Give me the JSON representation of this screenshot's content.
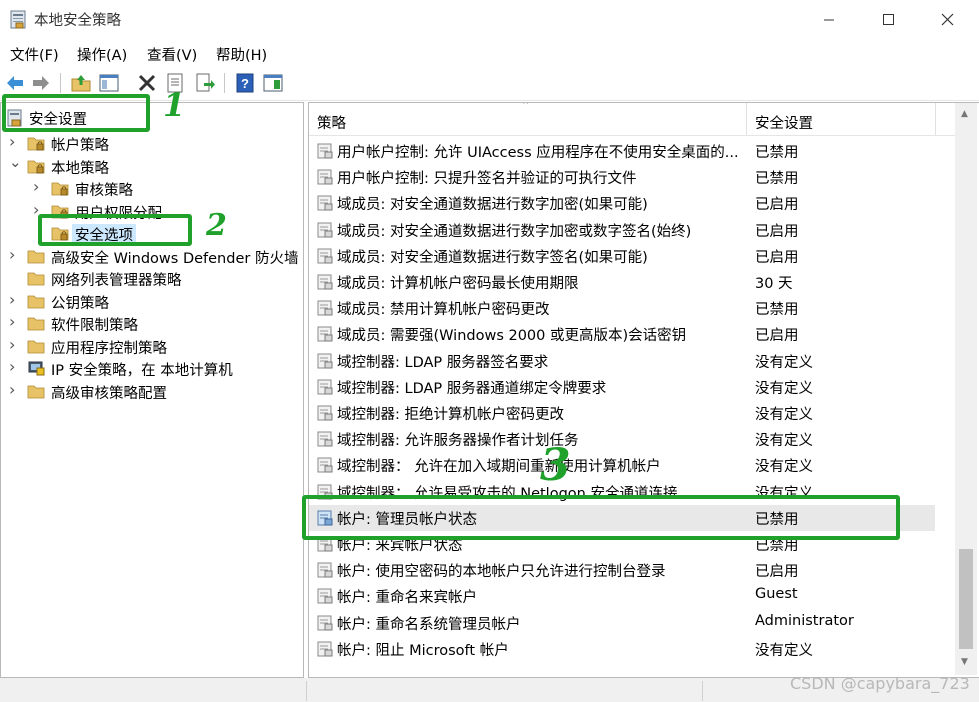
{
  "window": {
    "title": "本地安全策略",
    "controls": {
      "minimize": "minimize-icon",
      "maximize": "maximize-icon",
      "close": "close-icon"
    }
  },
  "menu": [
    "文件(F)",
    "操作(A)",
    "查看(V)",
    "帮助(H)"
  ],
  "toolbar": [
    "back-arrow-icon",
    "forward-arrow-icon",
    "up-folder-icon",
    "show-hide-tree-icon",
    "delete-icon",
    "properties-icon",
    "export-list-icon",
    "help-icon",
    "console-pane-icon"
  ],
  "tree": {
    "root": "安全设置",
    "items": [
      {
        "label": "帐户策略",
        "level": 1,
        "expand": "collapsed",
        "icon": "folder-lock-icon"
      },
      {
        "label": "本地策略",
        "level": 1,
        "expand": "expanded",
        "icon": "folder-lock-icon"
      },
      {
        "label": "审核策略",
        "level": 2,
        "expand": "collapsed",
        "icon": "folder-lock-icon"
      },
      {
        "label": "用户权限分配",
        "level": 2,
        "expand": "collapsed",
        "icon": "folder-lock-icon"
      },
      {
        "label": "安全选项",
        "level": 2,
        "expand": "none",
        "icon": "folder-lock-icon",
        "selected": true
      },
      {
        "label": "高级安全 Windows Defender 防火墙",
        "level": 1,
        "expand": "collapsed",
        "icon": "folder-icon"
      },
      {
        "label": "网络列表管理器策略",
        "level": 1,
        "expand": "none",
        "icon": "folder-icon"
      },
      {
        "label": "公钥策略",
        "level": 1,
        "expand": "collapsed",
        "icon": "folder-icon"
      },
      {
        "label": "软件限制策略",
        "level": 1,
        "expand": "collapsed",
        "icon": "folder-icon"
      },
      {
        "label": "应用程序控制策略",
        "level": 1,
        "expand": "collapsed",
        "icon": "folder-icon"
      },
      {
        "label": "IP 安全策略，在 本地计算机",
        "level": 1,
        "expand": "collapsed",
        "icon": "ip-security-icon"
      },
      {
        "label": "高级审核策略配置",
        "level": 1,
        "expand": "collapsed",
        "icon": "folder-icon"
      }
    ]
  },
  "list": {
    "columns": {
      "policy": "策略",
      "setting": "安全设置"
    },
    "rows": [
      {
        "policy": "用户帐户控制: 允许 UIAccess 应用程序在不使用安全桌面的...",
        "setting": "已禁用"
      },
      {
        "policy": "用户帐户控制: 只提升签名并验证的可执行文件",
        "setting": "已禁用"
      },
      {
        "policy": "域成员: 对安全通道数据进行数字加密(如果可能)",
        "setting": "已启用"
      },
      {
        "policy": "域成员: 对安全通道数据进行数字加密或数字签名(始终)",
        "setting": "已启用"
      },
      {
        "policy": "域成员: 对安全通道数据进行数字签名(如果可能)",
        "setting": "已启用"
      },
      {
        "policy": "域成员: 计算机帐户密码最长使用期限",
        "setting": "30 天"
      },
      {
        "policy": "域成员: 禁用计算机帐户密码更改",
        "setting": "已禁用"
      },
      {
        "policy": "域成员: 需要强(Windows 2000 或更高版本)会话密钥",
        "setting": "已启用"
      },
      {
        "policy": "域控制器: LDAP 服务器签名要求",
        "setting": "没有定义"
      },
      {
        "policy": "域控制器: LDAP 服务器通道绑定令牌要求",
        "setting": "没有定义"
      },
      {
        "policy": "域控制器: 拒绝计算机帐户密码更改",
        "setting": "没有定义"
      },
      {
        "policy": "域控制器: 允许服务器操作者计划任务",
        "setting": "没有定义"
      },
      {
        "policy": "域控制器：  允许在加入域期间重新使用计算机帐户",
        "setting": "没有定义"
      },
      {
        "policy": "域控制器：  允许易受攻击的 Netlogon 安全通道连接",
        "setting": "没有定义"
      },
      {
        "policy": "帐户: 管理员帐户状态",
        "setting": "已禁用",
        "selected": true
      },
      {
        "policy": "帐户: 来宾帐户状态",
        "setting": "已禁用"
      },
      {
        "policy": "帐户: 使用空密码的本地帐户只允许进行控制台登录",
        "setting": "已启用"
      },
      {
        "policy": "帐户: 重命名来宾帐户",
        "setting": "Guest"
      },
      {
        "policy": "帐户: 重命名系统管理员帐户",
        "setting": "Administrator"
      },
      {
        "policy": "帐户: 阻止 Microsoft 帐户",
        "setting": "没有定义"
      }
    ]
  },
  "annotations": {
    "step1": "1",
    "step2": "2",
    "step3": "3",
    "color": "#1fa12c"
  },
  "watermark": "CSDN @capybara_723",
  "colors": {
    "selection": "#cce8ff",
    "folder": "#e8c266"
  }
}
